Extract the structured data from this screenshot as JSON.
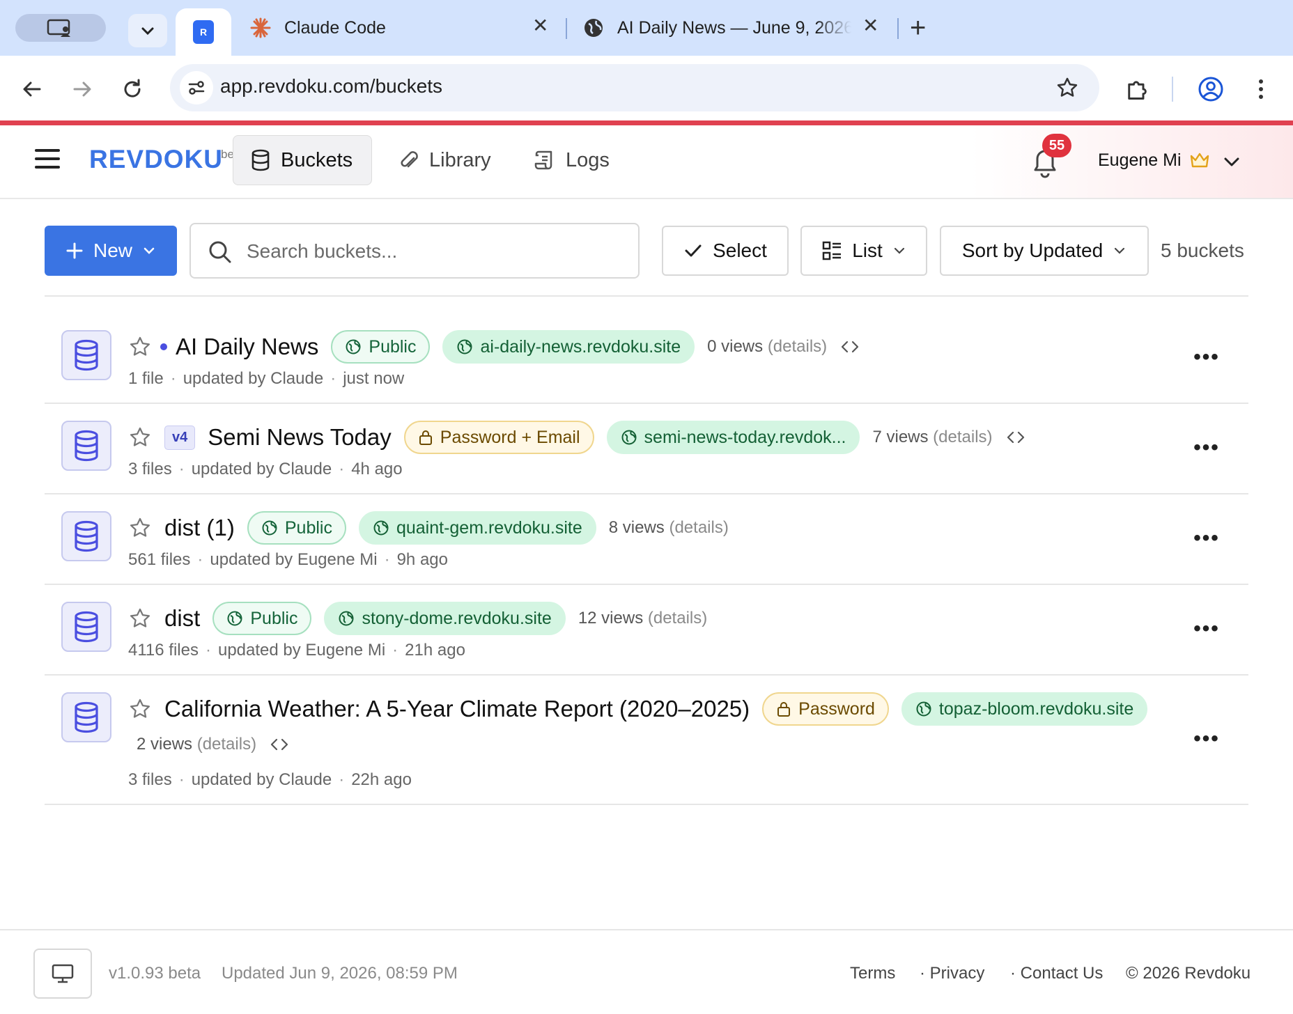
{
  "browser": {
    "tabs": [
      {
        "title": "Claude Code",
        "favicon": "claude-asterisk-icon"
      },
      {
        "title": "AI Daily News — June 9, 2026",
        "favicon": "globe-icon"
      }
    ],
    "url": "app.revdoku.com/buckets"
  },
  "app": {
    "brand": "REVDOKU",
    "brand_beta": "beta",
    "nav": [
      {
        "label": "Buckets",
        "active": true
      },
      {
        "label": "Library"
      },
      {
        "label": "Logs"
      }
    ],
    "notifications_count": "55",
    "user_name": "Eugene Mi"
  },
  "controls": {
    "new_label": "New",
    "search_placeholder": "Search buckets...",
    "select_label": "Select",
    "view_label": "List",
    "sort_label": "Sort by Updated",
    "bucket_count": "5 buckets"
  },
  "buckets": [
    {
      "name": "AI Daily News",
      "version": "",
      "access": "Public",
      "domain": "ai-daily-news.revdoku.site",
      "views": "0 views",
      "details": "(details)",
      "files": "1 file",
      "updated_by": "updated by Claude",
      "updated_at": "just now"
    },
    {
      "name": "Semi News Today",
      "version": "v4",
      "access": "Password + Email",
      "domain": "semi-news-today.revdok...",
      "views": "7 views",
      "details": "(details)",
      "files": "3 files",
      "updated_by": "updated by Claude",
      "updated_at": "4h ago"
    },
    {
      "name": "dist (1)",
      "version": "",
      "access": "Public",
      "domain": "quaint-gem.revdoku.site",
      "views": "8 views",
      "details": "(details)",
      "files": "561 files",
      "updated_by": "updated by Eugene Mi",
      "updated_at": "9h ago"
    },
    {
      "name": "dist",
      "version": "",
      "access": "Public",
      "domain": "stony-dome.revdoku.site",
      "views": "12 views",
      "details": "(details)",
      "files": "4116 files",
      "updated_by": "updated by Eugene Mi",
      "updated_at": "21h ago"
    },
    {
      "name": "California Weather: A 5-Year Climate Report (2020–2025)",
      "version": "",
      "access": "Password",
      "domain": "topaz-bloom.revdoku.site",
      "views": "2 views",
      "details": "(details)",
      "files": "3 files",
      "updated_by": "updated by Claude",
      "updated_at": "22h ago"
    }
  ],
  "footer": {
    "version": "v1.0.93 beta",
    "updated": "Updated Jun 9, 2026, 08:59 PM",
    "terms": "Terms",
    "privacy": "· Privacy",
    "contact": "· Contact Us",
    "copyright": "© 2026 Revdoku"
  },
  "colors": {
    "accent": "#3a74e3",
    "badge": "#e0323e",
    "public_green": "#15643a",
    "password_amber": "#6b4a00",
    "bucket_icon": "#4a4ee0"
  }
}
